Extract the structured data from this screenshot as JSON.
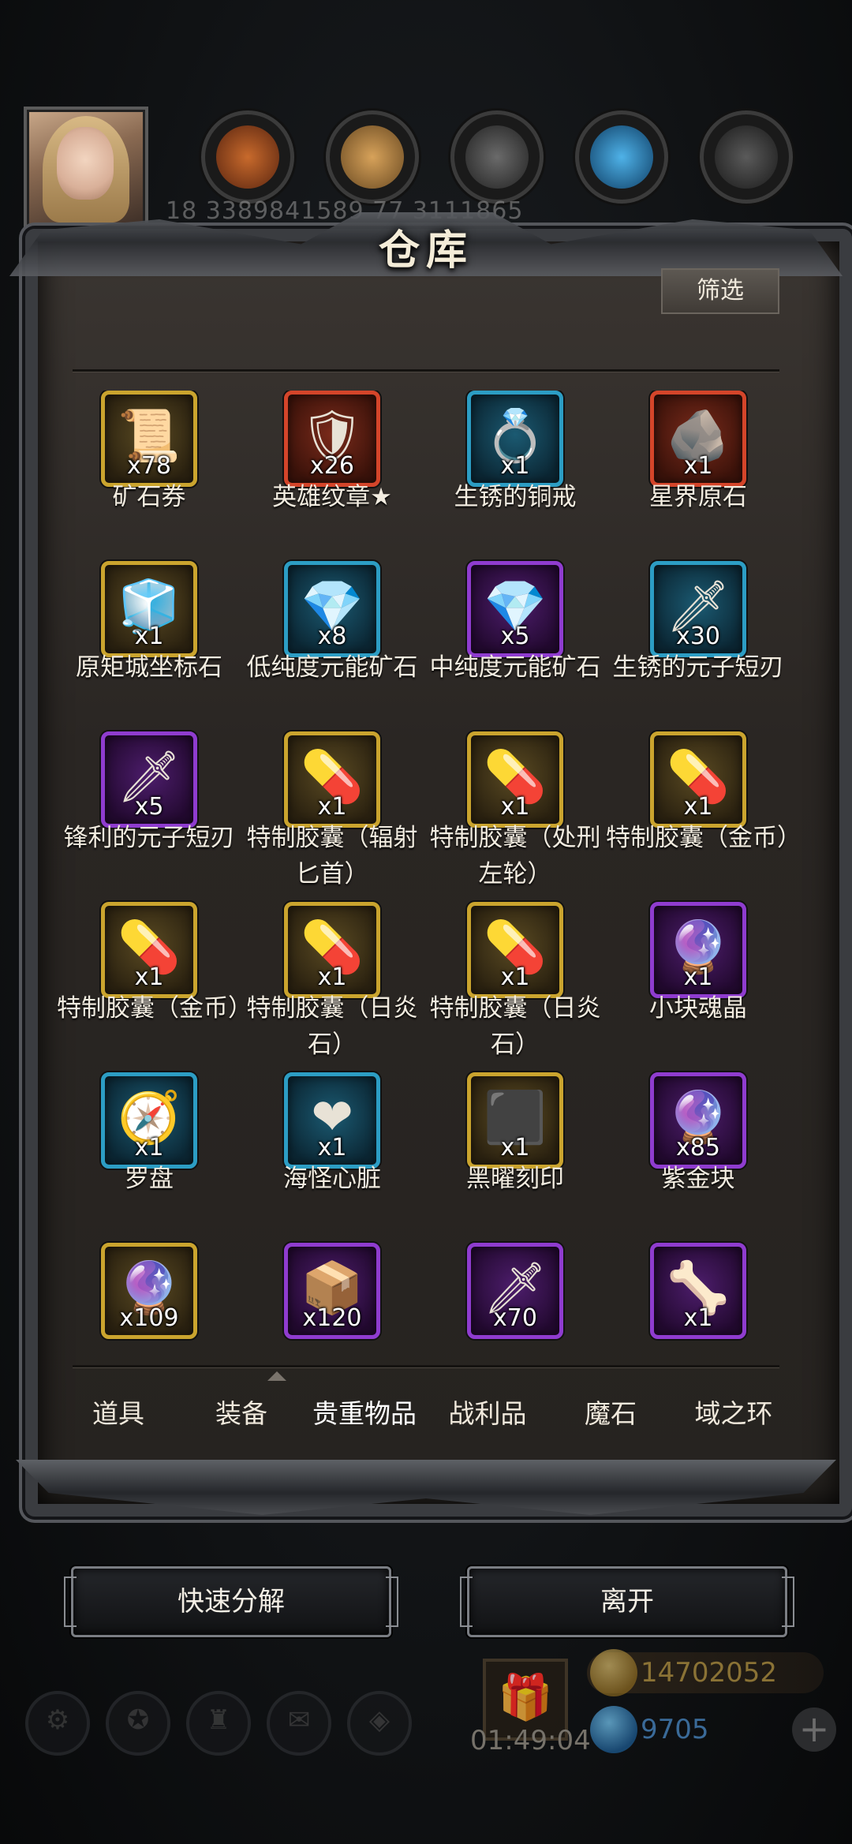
{
  "hud": {
    "resource_strip": "18  3389841589  77  3111865",
    "resources": [
      {
        "icon": "meat-resource-icon",
        "color": "#b5521f"
      },
      {
        "icon": "wood-resource-icon",
        "color": "#c28a45"
      },
      {
        "icon": "stone-resource-icon",
        "color": "#4a4a4a"
      },
      {
        "icon": "crystal-resource-icon",
        "color": "#2b86c6"
      },
      {
        "icon": "iron-resource-icon",
        "color": "#3a3a3a"
      }
    ]
  },
  "modal": {
    "title": "仓库",
    "filter_label": "筛选",
    "items": [
      {
        "name": "矿石券",
        "qty": "x78",
        "rarity": "gold",
        "art": "📜"
      },
      {
        "name": "英雄纹章★",
        "qty": "x26",
        "rarity": "red",
        "art": "🛡"
      },
      {
        "name": "生锈的铜戒",
        "qty": "x1",
        "rarity": "blue",
        "art": "💍"
      },
      {
        "name": "星界原石",
        "qty": "x1",
        "rarity": "red",
        "art": "🪨"
      },
      {
        "name": "原矩城坐标石",
        "qty": "x1",
        "rarity": "gold",
        "art": "🧊"
      },
      {
        "name": "低纯度元能矿石",
        "qty": "x8",
        "rarity": "blue",
        "art": "💎"
      },
      {
        "name": "中纯度元能矿石",
        "qty": "x5",
        "rarity": "purple",
        "art": "💎"
      },
      {
        "name": "生锈的元子短刃",
        "qty": "x30",
        "rarity": "blue",
        "art": "🗡"
      },
      {
        "name": "锋利的元子短刃",
        "qty": "x5",
        "rarity": "purple",
        "art": "🗡"
      },
      {
        "name": "特制胶囊（辐射匕首）",
        "qty": "x1",
        "rarity": "gold",
        "art": "💊"
      },
      {
        "name": "特制胶囊（处刑左轮）",
        "qty": "x1",
        "rarity": "gold",
        "art": "💊"
      },
      {
        "name": "特制胶囊（金币）",
        "qty": "x1",
        "rarity": "gold",
        "art": "💊"
      },
      {
        "name": "特制胶囊（金币）",
        "qty": "x1",
        "rarity": "gold",
        "art": "💊"
      },
      {
        "name": "特制胶囊（日炎石）",
        "qty": "x1",
        "rarity": "gold",
        "art": "💊"
      },
      {
        "name": "特制胶囊（日炎石）",
        "qty": "x1",
        "rarity": "gold",
        "art": "💊"
      },
      {
        "name": "小块魂晶",
        "qty": "x1",
        "rarity": "purple",
        "art": "🔮"
      },
      {
        "name": "罗盘",
        "qty": "x1",
        "rarity": "blue",
        "art": "🧭"
      },
      {
        "name": "海怪心脏",
        "qty": "x1",
        "rarity": "blue",
        "art": "❤"
      },
      {
        "name": "黑曜刻印",
        "qty": "x1",
        "rarity": "gold",
        "art": "⬛"
      },
      {
        "name": "紫金块",
        "qty": "x85",
        "rarity": "purple",
        "art": "🔮"
      },
      {
        "name": "",
        "qty": "x109",
        "rarity": "gold",
        "art": "🔮"
      },
      {
        "name": "",
        "qty": "x120",
        "rarity": "purple",
        "art": "📦"
      },
      {
        "name": "",
        "qty": "x70",
        "rarity": "purple",
        "art": "🗡"
      },
      {
        "name": "",
        "qty": "x1",
        "rarity": "purple",
        "art": "🦴"
      }
    ],
    "tabs": [
      "道具",
      "装备",
      "贵重物品",
      "战利品",
      "魔石",
      "域之环"
    ],
    "active_tab": "贵重物品"
  },
  "actions": {
    "quick_decompose": "快速分解",
    "leave": "离开"
  },
  "footer": {
    "timer": "01:49:04",
    "gold": "14702052",
    "gems": "9705",
    "plus": "+"
  }
}
